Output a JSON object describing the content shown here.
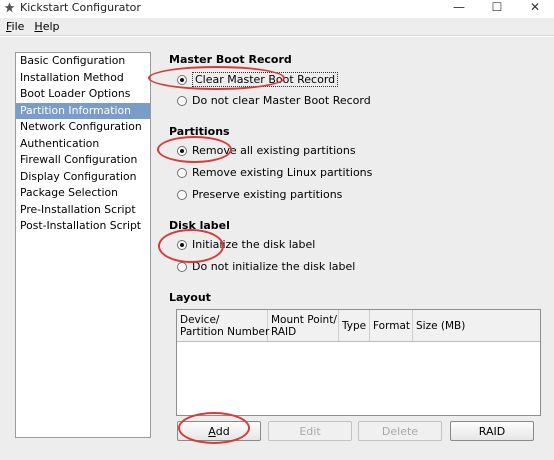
{
  "window": {
    "title": "Kickstart Configurator",
    "controls": {
      "minimize": "—",
      "maximize": "☐",
      "close": "✕"
    }
  },
  "menu": {
    "items": [
      {
        "label": "File",
        "mnemonic": "F",
        "rest": "ile"
      },
      {
        "label": "Help",
        "mnemonic": "H",
        "rest": "elp"
      }
    ]
  },
  "sidebar": {
    "items": [
      {
        "label": "Basic Configuration"
      },
      {
        "label": "Installation Method"
      },
      {
        "label": "Boot Loader Options"
      },
      {
        "label": "Partition Information",
        "selected": true
      },
      {
        "label": "Network Configuration"
      },
      {
        "label": "Authentication"
      },
      {
        "label": "Firewall Configuration"
      },
      {
        "label": "Display Configuration"
      },
      {
        "label": "Package Selection"
      },
      {
        "label": "Pre-Installation Script"
      },
      {
        "label": "Post-Installation Script"
      }
    ]
  },
  "mbr": {
    "title": "Master Boot Record",
    "options": [
      {
        "label": "Clear Master Boot Record",
        "checked": true
      },
      {
        "label": "Do not clear Master Boot Record",
        "checked": false
      }
    ]
  },
  "partitions": {
    "title": "Partitions",
    "options": [
      {
        "label": "Remove all existing partitions",
        "checked": true
      },
      {
        "label": "Remove existing Linux partitions",
        "checked": false
      },
      {
        "label": "Preserve existing partitions",
        "checked": false
      }
    ]
  },
  "disklabel": {
    "title": "Disk label",
    "options": [
      {
        "label": "Initialize the disk label",
        "checked": true
      },
      {
        "label": "Do not initialize the disk label",
        "checked": false
      }
    ]
  },
  "layout": {
    "title": "Layout",
    "columns": [
      {
        "line1": "Device/",
        "line2": "Partition Number"
      },
      {
        "line1": "Mount Point/",
        "line2": "RAID"
      },
      {
        "line1": "Type",
        "line2": ""
      },
      {
        "line1": "Format",
        "line2": ""
      },
      {
        "line1": "Size (MB)",
        "line2": ""
      }
    ],
    "rows": []
  },
  "buttons": {
    "add": {
      "label": "Add",
      "mnemonic": "A",
      "rest": "dd",
      "enabled": true
    },
    "edit": {
      "label": "Edit",
      "enabled": false
    },
    "delete": {
      "label": "Delete",
      "enabled": false
    },
    "raid": {
      "label": "RAID",
      "enabled": true
    }
  },
  "annotation_color": "#d83a3a",
  "selection_color": "#7a9cc8"
}
